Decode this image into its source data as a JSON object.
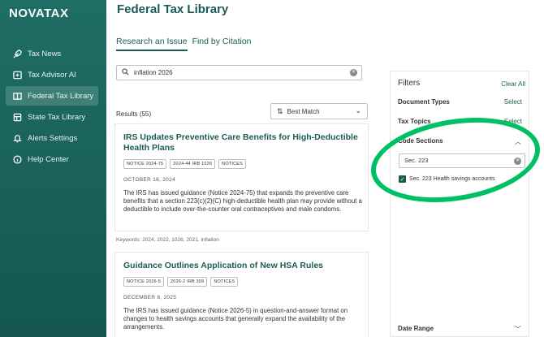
{
  "app": {
    "logo": "NOVATAX"
  },
  "sidebar": {
    "items": [
      {
        "label": "Tax News",
        "icon": "rocket-icon",
        "active": false
      },
      {
        "label": "Tax Advisor AI",
        "icon": "ai-chat-icon",
        "active": false
      },
      {
        "label": "Federal Tax Library",
        "icon": "book-icon",
        "active": true
      },
      {
        "label": "State Tax Library",
        "icon": "map-icon",
        "active": false
      },
      {
        "label": "Alerts Settings",
        "icon": "bell-icon",
        "active": false
      },
      {
        "label": "Help Center",
        "icon": "info-icon",
        "active": false
      }
    ]
  },
  "header": {
    "title": "Federal Tax Library"
  },
  "tabs": [
    {
      "label": "Research an Issue",
      "active": true
    },
    {
      "label": "Find by Citation",
      "active": false
    }
  ],
  "search": {
    "value": "inflation 2026"
  },
  "results": {
    "count": "Results (55)",
    "sort_label": "Best Match",
    "items": [
      {
        "title": "IRS Updates Preventive Care Benefits for High-Deductible Health Plans",
        "badges": [
          "NOTICE 2024-75",
          "2024-44 IRB 1026",
          "NOTICES"
        ],
        "date": "OCTOBER 16, 2024",
        "description": "The IRS has issued guidance (Notice 2024-75) that expands the preventive care benefits that a section 223(c)(2)(C) high-deductible health plan may provide without a deductible to include over-the-counter oral contraceptives and male condoms.",
        "keywords": "Keywords: 2024, 2022, 1026, 2021, inflation"
      },
      {
        "title": "Guidance Outlines Application of New HSA Rules",
        "badges": [
          "NOTICE 2026-5",
          "2026-2 IRB 309",
          "NOTICES"
        ],
        "date": "DECEMBER 8, 2025",
        "description": "The IRS has issued guidance (Notice 2026-5) in question-and-answer format on changes to health savings accounts that generally expand the availability of the arrangements."
      }
    ]
  },
  "filters": {
    "title": "Filters",
    "clear_all": "Clear All",
    "document_types": {
      "label": "Document Types",
      "action": "Select"
    },
    "tax_topics": {
      "label": "Tax Topics",
      "action": "Select"
    },
    "code_sections": {
      "label": "Code Sections",
      "input_value": "Sec. 223",
      "checkbox_label": "Sec. 223 Health savings accounts",
      "checked": true
    },
    "date_range": {
      "label": "Date Range"
    }
  },
  "annotation": {
    "color": "#00c065"
  },
  "colors": {
    "brand": "#1a5c55",
    "sidebar": "#1f6e66"
  }
}
